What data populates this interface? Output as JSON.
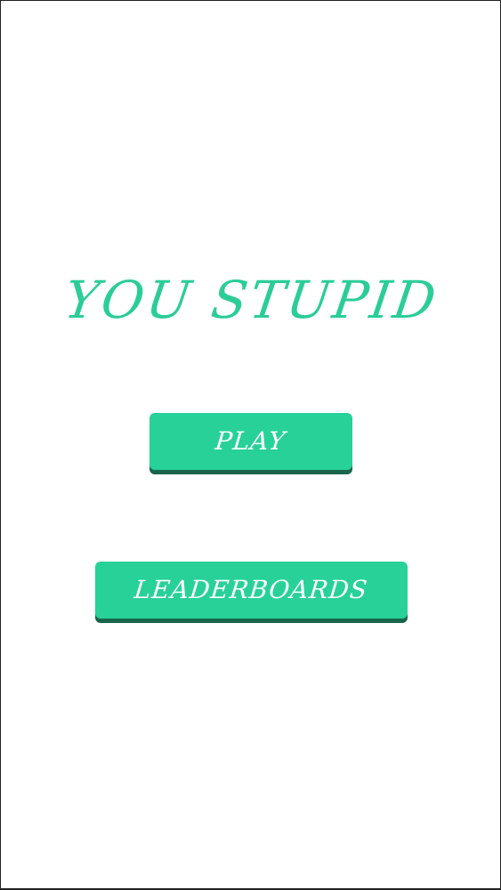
{
  "game": {
    "title": "YOU STUPID"
  },
  "menu": {
    "play_label": "PLAY",
    "leaderboards_label": "LEADERBOARDS"
  },
  "colors": {
    "background": "#ffffff",
    "title": "#2bcd97",
    "button_face": "#28d198",
    "button_shadow": "#18654b",
    "button_text": "#ffffff"
  }
}
